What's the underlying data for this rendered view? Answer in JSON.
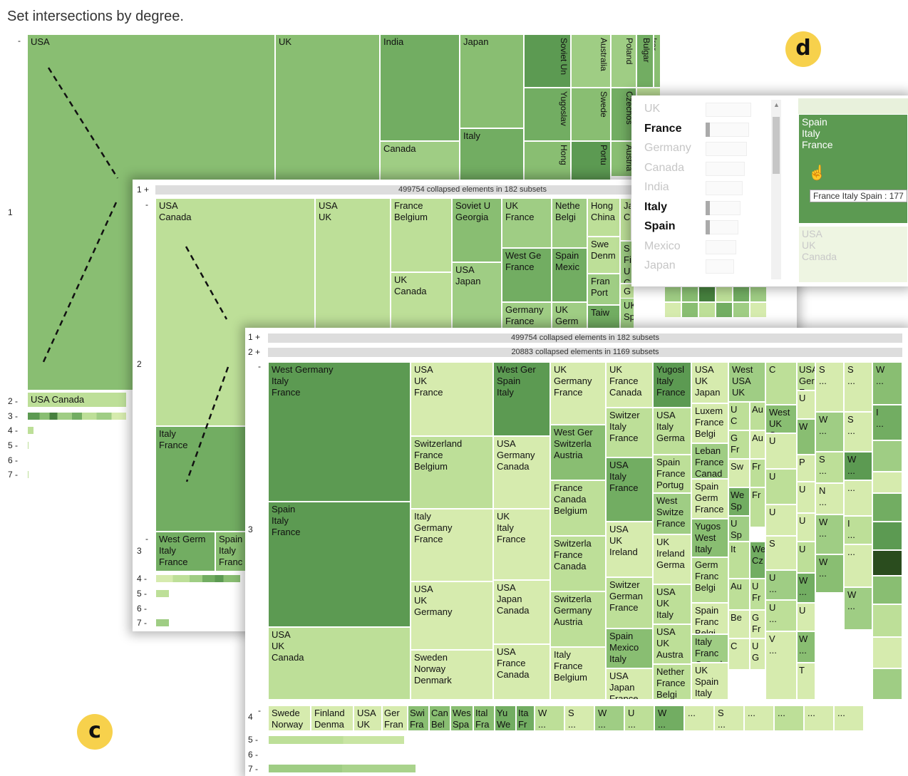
{
  "title": "Set intersections by degree.",
  "colors": {
    "c1": "#e8f4c4",
    "c2": "#d6ebae",
    "c3": "#bddf98",
    "c4": "#9fcd84",
    "c5": "#89be72",
    "c6": "#72ad62",
    "c7": "#5c9a52",
    "c8": "#46803e",
    "c9": "#2a4c1e"
  },
  "badges": {
    "d": "d",
    "c": "c"
  },
  "panel1": {
    "degrees": {
      "d0": "-",
      "d1": "1",
      "d2": "2 -",
      "d3": "3 -",
      "d4": "4 -",
      "d5": "5 -",
      "d6": "6 -",
      "d7": "7 -"
    },
    "cells": [
      {
        "t": "USA",
        "c": "c5"
      },
      {
        "t": "UK",
        "c": "c5"
      },
      {
        "t": "India",
        "c": "c6"
      },
      {
        "t": "Japan",
        "c": "c5"
      },
      {
        "t": "Soviet Un",
        "c": "c7"
      },
      {
        "t": "Australia",
        "c": "c4"
      },
      {
        "t": "Poland",
        "c": "c4"
      },
      {
        "t": "Bulgar",
        "c": "c6"
      },
      {
        "t": "Irar",
        "c": "c5"
      },
      {
        "t": "Yugoslav",
        "c": "c6"
      },
      {
        "t": "Swede",
        "c": "c5"
      },
      {
        "t": "Czechos",
        "c": "c6"
      },
      {
        "t": "Austria",
        "c": "c5"
      },
      {
        "t": "Italy",
        "c": "c6"
      },
      {
        "t": "Canada",
        "c": "c4"
      },
      {
        "t": "Hong",
        "c": "c5"
      },
      {
        "t": "Portu",
        "c": "c7"
      },
      {
        "t": "",
        "c": "c3"
      },
      {
        "t": "USA Canada",
        "c": "c3"
      }
    ]
  },
  "panel2": {
    "collapsed": "499754 collapsed elements in 182 subsets",
    "degrees": {
      "p1": "1 +",
      "d0": "-",
      "d2": "2",
      "d3d": "-",
      "d3": "3",
      "d4": "4 -",
      "d5": "5 -",
      "d6": "6 -",
      "d7": "7 -"
    },
    "cells": [
      {
        "t": "USA\nCanada",
        "c": "c3"
      },
      {
        "t": "Italy\nFrance",
        "c": "c6"
      },
      {
        "t": "USA\nUK",
        "c": "c3"
      },
      {
        "t": "France\nBelgium",
        "c": "c3"
      },
      {
        "t": "UK\nCanada",
        "c": "c3"
      },
      {
        "t": "Soviet U\nGeorgia",
        "c": "c5"
      },
      {
        "t": "USA\nJapan",
        "c": "c4"
      },
      {
        "t": "UK\nFrance",
        "c": "c4"
      },
      {
        "t": "West Ge\nFrance",
        "c": "c6"
      },
      {
        "t": "Germany\nFrance",
        "c": "c4"
      },
      {
        "t": "Nethe\nBelgi",
        "c": "c4"
      },
      {
        "t": "Spain\nMexic",
        "c": "c6"
      },
      {
        "t": "UK\nGerm",
        "c": "c4"
      },
      {
        "t": "Hong\nChina",
        "c": "c3"
      },
      {
        "t": "Swe\nDenm",
        "c": "c3"
      },
      {
        "t": "Fran\nPort",
        "c": "c4"
      },
      {
        "t": "Taiw",
        "c": "c6"
      },
      {
        "t": "Ja\nC",
        "c": "c3"
      },
      {
        "t": "S\nFi\nU\nC",
        "c": "c4"
      },
      {
        "t": "G\nCan",
        "c": "c3"
      },
      {
        "t": "UK\nSpa",
        "c": "c4"
      },
      {
        "t": "West Germ\nItaly\nFrance",
        "c": "c6"
      },
      {
        "t": "Spain\nItaly\nFranc",
        "c": "c5"
      }
    ]
  },
  "panel3": {
    "collapsed1": "499754 collapsed elements in 182 subsets",
    "collapsed2": "20883 collapsed elements in 1169 subsets",
    "degrees": {
      "p1": "1 +",
      "p2": "2 +",
      "d3d": "-",
      "d3": "3",
      "d4": "4",
      "d4d": "-",
      "d5": "5 -",
      "d6": "6 -",
      "d7": "7 -"
    },
    "cells": [
      {
        "t": "West Germany\nItaly\nFrance",
        "c": "c7"
      },
      {
        "t": "Spain\nItaly\nFrance",
        "c": "c7"
      },
      {
        "t": "USA\nUK\nCanada",
        "c": "c3"
      },
      {
        "t": "USA\nUK\nFrance",
        "c": "c2"
      },
      {
        "t": "Switzerland\nFrance\nBelgium",
        "c": "c3"
      },
      {
        "t": "Italy\nGermany\nFrance",
        "c": "c2"
      },
      {
        "t": "USA\nUK\nGermany",
        "c": "c2"
      },
      {
        "t": "Sweden\nNorway\nDenmark",
        "c": "c2"
      },
      {
        "t": "West Ger\nSpain\nItaly",
        "c": "c7"
      },
      {
        "t": "USA\nGermany\nCanada",
        "c": "c2"
      },
      {
        "t": "UK\nItaly\nFrance",
        "c": "c2"
      },
      {
        "t": "USA\nJapan\nCanada",
        "c": "c2"
      },
      {
        "t": "USA\nFrance\nCanada",
        "c": "c2"
      },
      {
        "t": "UK\nGermany\nFrance",
        "c": "c2"
      },
      {
        "t": "West Ger\nSwitzerla\nAustria",
        "c": "c5"
      },
      {
        "t": "France\nCanada\nBelgium",
        "c": "c3"
      },
      {
        "t": "Switzerla\nFrance\nCanada",
        "c": "c3"
      },
      {
        "t": "Switzerla\nGermany\nAustria",
        "c": "c3"
      },
      {
        "t": "Italy\nFrance\nBelgium",
        "c": "c2"
      },
      {
        "t": "UK\nFrance\nCanada",
        "c": "c2"
      },
      {
        "t": "Switzer\nItaly\nFrance",
        "c": "c3"
      },
      {
        "t": "USA\nItaly\nFrance",
        "c": "c6"
      },
      {
        "t": "USA\nUK\nIreland",
        "c": "c2"
      },
      {
        "t": "Switzer\nGerman\nFrance",
        "c": "c3"
      },
      {
        "t": "Spain\nMexico\nItaly",
        "c": "c5"
      },
      {
        "t": "USA\nJapan\nFrance",
        "c": "c2"
      },
      {
        "t": "Yugosl\nItaly\nFrance",
        "c": "c7"
      },
      {
        "t": "USA\nItaly\nGerma",
        "c": "c3"
      },
      {
        "t": "Spain\nFrance\nPortug",
        "c": "c3"
      },
      {
        "t": "West\nSwitze\nFrance",
        "c": "c4"
      },
      {
        "t": "UK\nIreland\nGerma",
        "c": "c2"
      },
      {
        "t": "USA\nUK\nItaly",
        "c": "c3"
      },
      {
        "t": "USA\nUK\nAustra",
        "c": "c3"
      },
      {
        "t": "Nether\nFrance\nBelgi",
        "c": "c3"
      },
      {
        "t": "USA\nUK\nJapan",
        "c": "c2"
      },
      {
        "t": "Luxem\nFrance\nBelgi",
        "c": "c2"
      },
      {
        "t": "Leban\nFrance\nCanad",
        "c": "c4"
      },
      {
        "t": "Spain\nGerm\nFrance",
        "c": "c2"
      },
      {
        "t": "Yugos\nWest\nItaly",
        "c": "c5"
      },
      {
        "t": "Germ\nFranc\nBelgi",
        "c": "c3"
      },
      {
        "t": "Spain\nFranc\nBelgi",
        "c": "c2"
      },
      {
        "t": "Italy\nFranc\nCanad",
        "c": "c4"
      },
      {
        "t": "UK\nSpain\nItaly",
        "c": "c2"
      },
      {
        "t": "West\nUSA\nUK",
        "c": "c4"
      },
      {
        "t": "U\nC",
        "c": "c3"
      },
      {
        "t": "Au",
        "c": "c3"
      },
      {
        "t": "G\nFr",
        "c": "c3"
      },
      {
        "t": "Au",
        "c": "c2"
      },
      {
        "t": "Sw",
        "c": "c2"
      },
      {
        "t": "Fr",
        "c": "c3"
      },
      {
        "t": "We\nSp",
        "c": "c6"
      },
      {
        "t": "Fr",
        "c": "c3"
      },
      {
        "t": "U\nSp",
        "c": "c4"
      },
      {
        "t": "It",
        "c": "c3"
      },
      {
        "t": "We\nCz",
        "c": "c6"
      },
      {
        "t": "Au",
        "c": "c3"
      },
      {
        "t": "U\nFr",
        "c": "c3"
      },
      {
        "t": "Be",
        "c": "c2"
      },
      {
        "t": "G\nFr",
        "c": "c2"
      },
      {
        "t": "C",
        "c": "c2"
      },
      {
        "t": "U\nG",
        "c": "c2"
      },
      {
        "t": "C",
        "c": "c3"
      },
      {
        "t": "West\nUK\nCana",
        "c": "c5"
      },
      {
        "t": "USA\nGer\nFran",
        "c": "c3"
      },
      {
        "t": "U",
        "c": "c2"
      },
      {
        "t": "U",
        "c": "c2"
      },
      {
        "t": "W",
        "c": "c5"
      },
      {
        "t": "U",
        "c": "c3"
      },
      {
        "t": "U",
        "c": "c2"
      },
      {
        "t": "S",
        "c": "c2"
      },
      {
        "t": "P",
        "c": "c2"
      },
      {
        "t": "U",
        "c": "c2"
      },
      {
        "t": "U",
        "c": "c2"
      },
      {
        "t": "U",
        "c": "c3"
      },
      {
        "t": "W\n...",
        "c": "c6"
      },
      {
        "t": "U",
        "c": "c2"
      },
      {
        "t": "W\n...",
        "c": "c5"
      },
      {
        "t": "T",
        "c": "c2"
      },
      {
        "t": "U\n...",
        "c": "c4"
      },
      {
        "t": "U\n...",
        "c": "c3"
      },
      {
        "t": "V\n...",
        "c": "c2"
      },
      {
        "t": "S\n...",
        "c": "c2"
      },
      {
        "t": "S\n...",
        "c": "c2"
      },
      {
        "t": "W\n...",
        "c": "c4"
      },
      {
        "t": "S\n...",
        "c": "c3"
      },
      {
        "t": "S\n...",
        "c": "c2"
      },
      {
        "t": "W\n...",
        "c": "c7"
      },
      {
        "t": "N\n...",
        "c": "c2"
      },
      {
        "t": "...",
        "c": "c2"
      },
      {
        "t": "W\n...",
        "c": "c4"
      },
      {
        "t": "W\n...",
        "c": "c5"
      },
      {
        "t": "I\n...",
        "c": "c3"
      },
      {
        "t": "...",
        "c": "c2"
      },
      {
        "t": "W\n...",
        "c": "c4"
      },
      {
        "t": "W\n...",
        "c": "c5"
      },
      {
        "t": "I\n...",
        "c": "c6"
      },
      {
        "t": "F\n...",
        "c": "c3"
      },
      {
        "t": "...",
        "c": "c2"
      },
      {
        "t": "...",
        "c": "c2"
      },
      {
        "t": "I\n...",
        "c": "c2"
      },
      {
        "t": "...",
        "c": "c2"
      },
      {
        "t": "...",
        "c": "c2"
      },
      {
        "t": "S\n...",
        "c": "c3"
      },
      {
        "t": "...",
        "c": "c2"
      },
      {
        "t": "...",
        "c": "c2"
      },
      {
        "t": "...",
        "c": "c2"
      },
      {
        "t": "Swede\nNorway",
        "c": "c2"
      },
      {
        "t": "Finland\nDenma",
        "c": "c2"
      },
      {
        "t": "USA\nUK",
        "c": "c2"
      },
      {
        "t": "Ger\nFran",
        "c": "c2"
      },
      {
        "t": "Swi\nFra",
        "c": "c5"
      },
      {
        "t": "Can\nBel",
        "c": "c5"
      },
      {
        "t": "Wes\nSpa",
        "c": "c5"
      },
      {
        "t": "Ital\nFra",
        "c": "c5"
      },
      {
        "t": "Yu\nWe",
        "c": "c6"
      },
      {
        "t": "Ita\nFr",
        "c": "c6"
      },
      {
        "t": "W\n...",
        "c": "c3"
      },
      {
        "t": "S\n...",
        "c": "c2"
      },
      {
        "t": "W\n...",
        "c": "c4"
      },
      {
        "t": "U\n...",
        "c": "c3"
      },
      {
        "t": "W\n...",
        "c": "c6"
      },
      {
        "t": "...",
        "c": "c2"
      },
      {
        "t": "S\n...",
        "c": "c2"
      },
      {
        "t": "...",
        "c": "c2"
      },
      {
        "t": "...",
        "c": "c3"
      },
      {
        "t": "...",
        "c": "c2"
      },
      {
        "t": "...",
        "c": "c2"
      }
    ]
  },
  "panel4": {
    "list": [
      {
        "label": "UK",
        "active": false
      },
      {
        "label": "France",
        "active": true
      },
      {
        "label": "Germany",
        "active": false
      },
      {
        "label": "Canada",
        "active": false
      },
      {
        "label": "India",
        "active": false
      },
      {
        "label": "Italy",
        "active": true
      },
      {
        "label": "Spain",
        "active": true
      },
      {
        "label": "Mexico",
        "active": false
      },
      {
        "label": "Japan",
        "active": false
      }
    ],
    "selected_cell": "Spain\nItaly\nFrance",
    "faded_cell": "USA\nUK\nCanada",
    "tooltip": "France Italy Spain : 177"
  }
}
